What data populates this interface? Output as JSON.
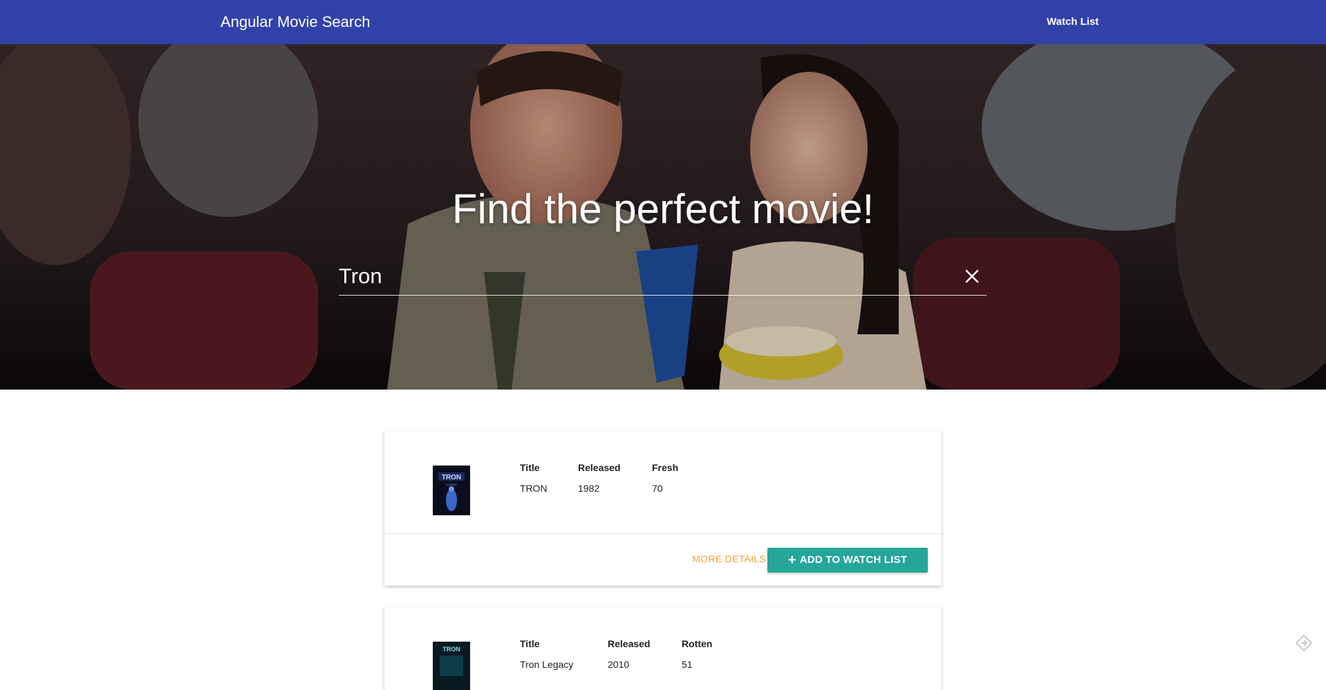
{
  "navbar": {
    "brand": "Angular Movie Search",
    "watch_list_link": "Watch List"
  },
  "hero": {
    "title": "Find the perfect movie!",
    "search": {
      "value": "Tron",
      "placeholder": ""
    },
    "clear_icon": "close-icon"
  },
  "results": [
    {
      "poster_alt": "TRON poster",
      "title_label": "Title",
      "title": "TRON",
      "released_label": "Released",
      "released": "1982",
      "score_label": "Fresh",
      "score": "70",
      "more_details": "MORE DETAILS",
      "add_to_watch_list": "ADD TO WATCH LIST"
    },
    {
      "poster_alt": "Tron Legacy poster",
      "title_label": "Title",
      "title": "Tron Legacy",
      "released_label": "Released",
      "released": "2010",
      "score_label": "Rotten",
      "score": "51"
    }
  ],
  "colors": {
    "navbar": "#3241a8",
    "accent_teal": "#26a69a",
    "accent_orange": "#f2a33a"
  }
}
